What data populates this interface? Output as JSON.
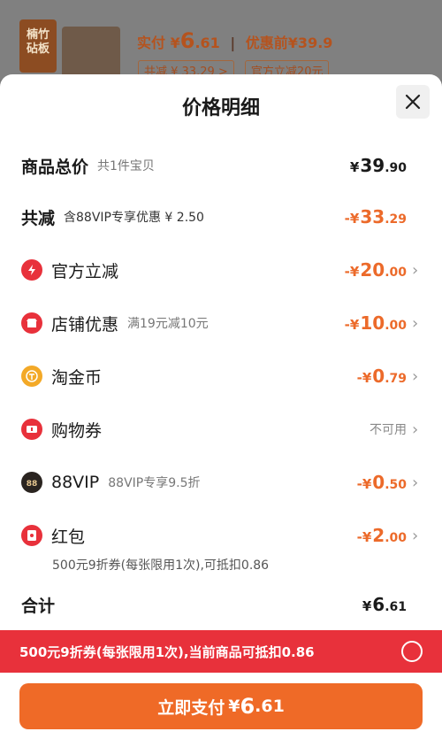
{
  "background": {
    "product_thumb_text": "楠竹\n砧板",
    "pay_label": "实付",
    "pay_currency": "¥",
    "pay_int": "6",
    "pay_dec": ".61",
    "before_label": "优惠前",
    "before_amount": "¥39.9",
    "chip_saved": "共减 ¥ 33.29 >",
    "chip_official": "官方立减20元"
  },
  "sheet": {
    "title": "价格明细",
    "close_icon": "close-icon"
  },
  "rows": {
    "total": {
      "label": "商品总价",
      "sub": "共1件宝贝",
      "currency": "¥",
      "int": "39",
      "dec": ".90"
    },
    "saved": {
      "label": "共减",
      "sub": "含88VIP专享优惠 ¥ 2.50",
      "currency": "-¥",
      "int": "33",
      "dec": ".29"
    },
    "official": {
      "label": "官方立减",
      "currency": "-¥",
      "int": "20",
      "dec": ".00",
      "icon": "lightning-icon"
    },
    "shop": {
      "label": "店铺优惠",
      "sub": "满19元减10元",
      "currency": "-¥",
      "int": "10",
      "dec": ".00",
      "icon": "shop-icon"
    },
    "coin": {
      "label": "淘金币",
      "currency": "-¥",
      "int": "0",
      "dec": ".79",
      "icon": "coin-icon"
    },
    "coupon": {
      "label": "购物券",
      "status": "不可用",
      "icon": "ticket-icon"
    },
    "vip": {
      "label": "88VIP",
      "sub": "88VIP专享9.5折",
      "currency": "-¥",
      "int": "0",
      "dec": ".50",
      "icon": "vip-icon"
    },
    "redpacket": {
      "label": "红包",
      "currency": "-¥",
      "int": "2",
      "dec": ".00",
      "icon": "red-packet-icon",
      "note": "500元9折券(每张限用1次),可抵扣0.86"
    },
    "sum": {
      "label": "合计",
      "currency": "¥",
      "int": "6",
      "dec": ".61"
    }
  },
  "banner": {
    "text": "500元9折券(每张限用1次),当前商品可抵扣0.86"
  },
  "pay_button": {
    "label": "立即支付",
    "currency": "¥",
    "int": "6",
    "dec": ".61"
  },
  "colors": {
    "accent": "#ef6a27",
    "banner": "#e8313b"
  }
}
